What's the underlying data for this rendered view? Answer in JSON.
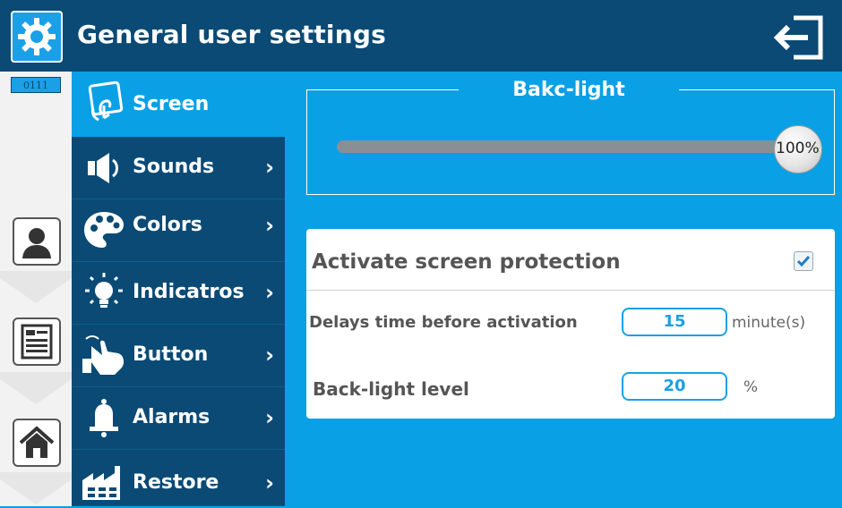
{
  "header": {
    "title": "General user settings"
  },
  "left": {
    "code": "0111"
  },
  "menu": {
    "items": [
      {
        "label": "Screen",
        "icon": "touch-screen-icon"
      },
      {
        "label": "Sounds",
        "icon": "speaker-icon"
      },
      {
        "label": "Colors",
        "icon": "palette-icon"
      },
      {
        "label": "Indicatros",
        "icon": "bulb-icon"
      },
      {
        "label": "Button",
        "icon": "hand-press-icon"
      },
      {
        "label": "Alarms",
        "icon": "bell-icon"
      },
      {
        "label": "Restore",
        "icon": "factory-icon"
      }
    ],
    "chevron": "›"
  },
  "backlight": {
    "title": "Bakc-light",
    "value_label": "100%",
    "value": 100
  },
  "protection": {
    "title": "Activate screen protection",
    "checked": true,
    "delay_label": "Delays time before activation",
    "delay_value": "15",
    "delay_unit": "minute(s)",
    "level_label": "Back-light level",
    "level_value": "20",
    "level_unit": "%"
  },
  "colors": {
    "dark_blue": "#0a4a75",
    "bright_blue": "#0aa0e6"
  }
}
